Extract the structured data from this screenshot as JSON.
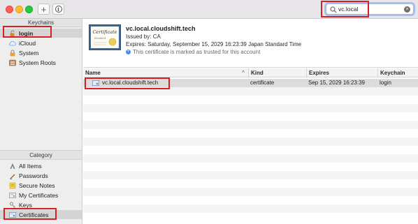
{
  "toolbar": {
    "add_label": "+",
    "info_label": "i"
  },
  "search": {
    "value": "vc.local",
    "clear_label": "×"
  },
  "sidebar": {
    "keychains_header": "Keychains",
    "keychains": [
      {
        "label": "login",
        "icon": "unlocked-padlock-icon"
      },
      {
        "label": "iCloud",
        "icon": "cloud-icon"
      },
      {
        "label": "System",
        "icon": "padlock-icon"
      },
      {
        "label": "System Roots",
        "icon": "cabinet-icon"
      }
    ],
    "category_header": "Category",
    "categories": [
      {
        "label": "All Items",
        "icon": "all-items-icon"
      },
      {
        "label": "Passwords",
        "icon": "pen-icon"
      },
      {
        "label": "Secure Notes",
        "icon": "note-icon"
      },
      {
        "label": "My Certificates",
        "icon": "my-cert-icon"
      },
      {
        "label": "Keys",
        "icon": "key-icon"
      },
      {
        "label": "Certificates",
        "icon": "certificate-icon"
      }
    ]
  },
  "certificate": {
    "image_text": "Certificate",
    "image_subtext": "Standard",
    "title": "vc.local.cloudshift.tech",
    "issuer": "Issued by: CA",
    "expires": "Expires: Saturday, September 15, 2029 16:23:39 Japan Standard Time",
    "trust_text": "This certificate is marked as trusted for this account"
  },
  "table": {
    "columns": [
      "Name",
      "Kind",
      "Expires",
      "Keychain"
    ],
    "sort_indicator": "^",
    "rows": [
      {
        "name": "vc.local.cloudshift.tech",
        "kind": "certificate",
        "expires": "Sep 15, 2029 16:23:39",
        "keychain": "login"
      }
    ]
  },
  "colors": {
    "highlight": "#d81f26",
    "selection": "#d6d5d6",
    "accent": "#3d8ff3"
  }
}
